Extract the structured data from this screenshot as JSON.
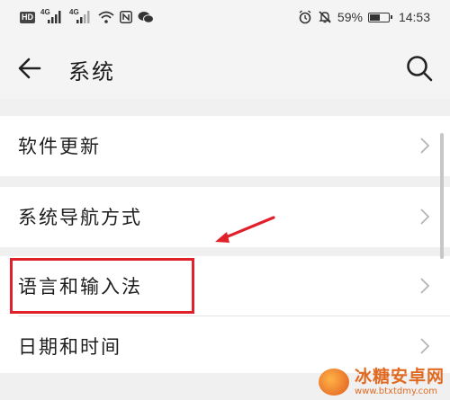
{
  "statusbar": {
    "hd_label": "HD",
    "net1_label": "4G",
    "net2_label": "4G",
    "battery_percent_text": "59%",
    "battery_level": 0.59,
    "time": "14:53",
    "icons": [
      "wifi-icon",
      "nfc-icon",
      "wechat-icon",
      "alarm-icon",
      "mute-icon",
      "battery-icon"
    ]
  },
  "header": {
    "title": "系统",
    "back_icon": "back-arrow-icon",
    "search_icon": "search-icon"
  },
  "settings": {
    "items": [
      {
        "label": "软件更新"
      },
      {
        "label": "系统导航方式"
      },
      {
        "label": "语言和输入法"
      },
      {
        "label": "日期和时间"
      }
    ]
  },
  "annotation": {
    "highlight_color": "#e0202a",
    "highlighted_item": "语言和输入法"
  },
  "watermark": {
    "title": "冰糖安卓网",
    "url": "www.btxtdmy.com"
  }
}
